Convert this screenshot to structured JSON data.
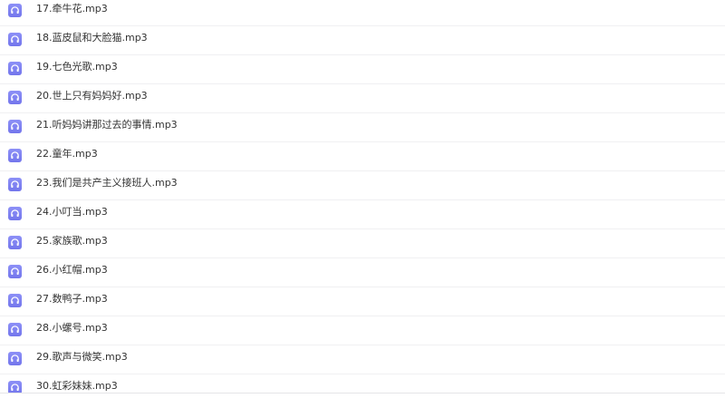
{
  "icons": {
    "file": "headphones-icon",
    "color": "#7f82f3"
  },
  "files": [
    {
      "name": "17.牵牛花.mp3"
    },
    {
      "name": "18.蓝皮鼠和大脸猫.mp3"
    },
    {
      "name": "19.七色光歌.mp3"
    },
    {
      "name": "20.世上只有妈妈好.mp3"
    },
    {
      "name": "21.听妈妈讲那过去的事情.mp3"
    },
    {
      "name": "22.童年.mp3"
    },
    {
      "name": "23.我们是共产主义接班人.mp3"
    },
    {
      "name": "24.小叮当.mp3"
    },
    {
      "name": "25.家族歌.mp3"
    },
    {
      "name": "26.小红帽.mp3"
    },
    {
      "name": "27.数鸭子.mp3"
    },
    {
      "name": "28.小螺号.mp3"
    },
    {
      "name": "29.歌声与微笑.mp3"
    },
    {
      "name": "30.虹彩妹妹.mp3"
    }
  ]
}
